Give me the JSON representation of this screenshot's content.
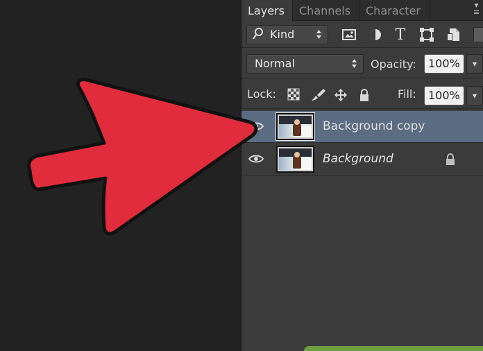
{
  "layers_panel": {
    "tabs": [
      "Layers",
      "Channels",
      "Character"
    ],
    "filter": {
      "kind": "Kind",
      "icons": [
        "pixel-layer-filter",
        "adjustment-layer-filter",
        "type-layer-filter",
        "shape-layer-filter",
        "smart-object-filter"
      ]
    },
    "blend": {
      "mode": "Normal",
      "opacity_label": "Opacity:",
      "opacity": "100%"
    },
    "lock": {
      "label": "Lock:",
      "fill_label": "Fill:",
      "fill": "100%",
      "icons": [
        "lock-transparent-pixels",
        "lock-image-pixels",
        "lock-position",
        "lock-all"
      ]
    },
    "layers": [
      {
        "name": "Background copy",
        "selected": true,
        "visible": true,
        "locked": false
      },
      {
        "name": "Background",
        "selected": false,
        "visible": true,
        "locked": true
      }
    ]
  },
  "annotation": {
    "arrow_color": "#e12c3d",
    "arrow_outline": "#111111"
  },
  "colors": {
    "canvas": "#222222",
    "panel": "#3b3b3b",
    "selected_layer": "#5c6c82",
    "accent": "#6ea03f"
  }
}
